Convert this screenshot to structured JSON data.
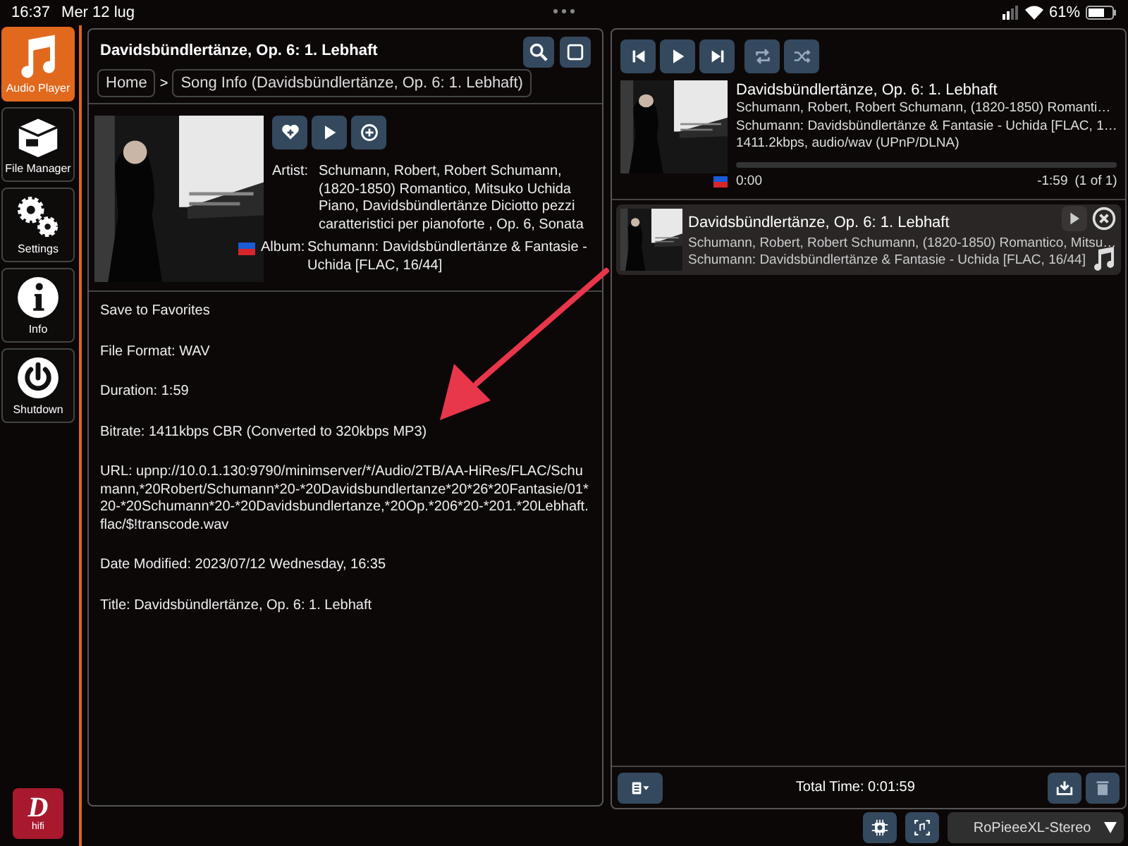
{
  "status_bar": {
    "time": "16:37",
    "date": "Mer 12 lug",
    "battery": "61%"
  },
  "sidebar": {
    "items": [
      {
        "label": "Audio Player",
        "selected": true
      },
      {
        "label": "File Manager",
        "selected": false
      },
      {
        "label": "Settings",
        "selected": false
      },
      {
        "label": "Info",
        "selected": false
      },
      {
        "label": "Shutdown",
        "selected": false
      }
    ],
    "logo": {
      "letter": "D",
      "text": "hifi"
    }
  },
  "song_info": {
    "title": "Davidsbündlertänze, Op. 6: 1. Lebhaft",
    "breadcrumb": [
      "Home",
      "Song Info (Davidsbündlertänze, Op. 6: 1. Lebhaft)"
    ],
    "breadcrumb_separator": ">",
    "artist_label": "Artist:",
    "artist": "Schumann, Robert, Robert Schumann, (1820-1850) Romantico, Mitsuko Uchida Piano, Davidsbündlertänze Diciotto pezzi caratteristici per pianoforte , Op. 6, Sonata",
    "album_label": "Album:",
    "album": "Schumann: Davidsbündlertänze & Fantasie - Uchida [FLAC, 16/44]",
    "details": [
      "Save to Favorites",
      "File Format: WAV",
      "Duration: 1:59",
      "Bitrate: 1411kbps CBR (Converted to 320kbps MP3)",
      "URL: upnp://10.0.1.130:9790/minimserver/*/Audio/2TB/AA-HiRes/FLAC/Schumann,*20Robert/Schumann*20-*20Davidsbundlertanze*20*26*20Fantasie/01*20-*20Schumann*20-*20Davidsbundlertanze,*20Op.*206*20-*201.*20Lebhaft.flac/$!transcode.wav",
      "Date Modified: 2023/07/12 Wednesday, 16:35",
      "Title: Davidsbündlertänze, Op. 6: 1. Lebhaft"
    ]
  },
  "now_playing": {
    "title": "Davidsbündlertänze, Op. 6: 1. Lebhaft",
    "artist": "Schumann, Robert, Robert Schumann, (1820-1850) Romanti…",
    "album": "Schumann: Davidsbündlertänze & Fantasie - Uchida [FLAC, 1…",
    "format": "1411.2kbps, audio/wav (UPnP/DLNA)",
    "level": 0,
    "elapsed": "0:00",
    "remaining": "-1:59",
    "position": "(1 of 1)"
  },
  "playlist": [
    {
      "title": "Davidsbündlertänze, Op. 6: 1. Lebhaft",
      "artist": "Schumann, Robert, Robert Schumann, (1820-1850) Romantico, Mitsu…",
      "album": "Schumann: Davidsbündlertänze & Fantasie - Uchida [FLAC, 16/44]"
    }
  ],
  "total_time": "Total Time: 0:01:59",
  "output_device": "RoPieeeXL-Stereo"
}
